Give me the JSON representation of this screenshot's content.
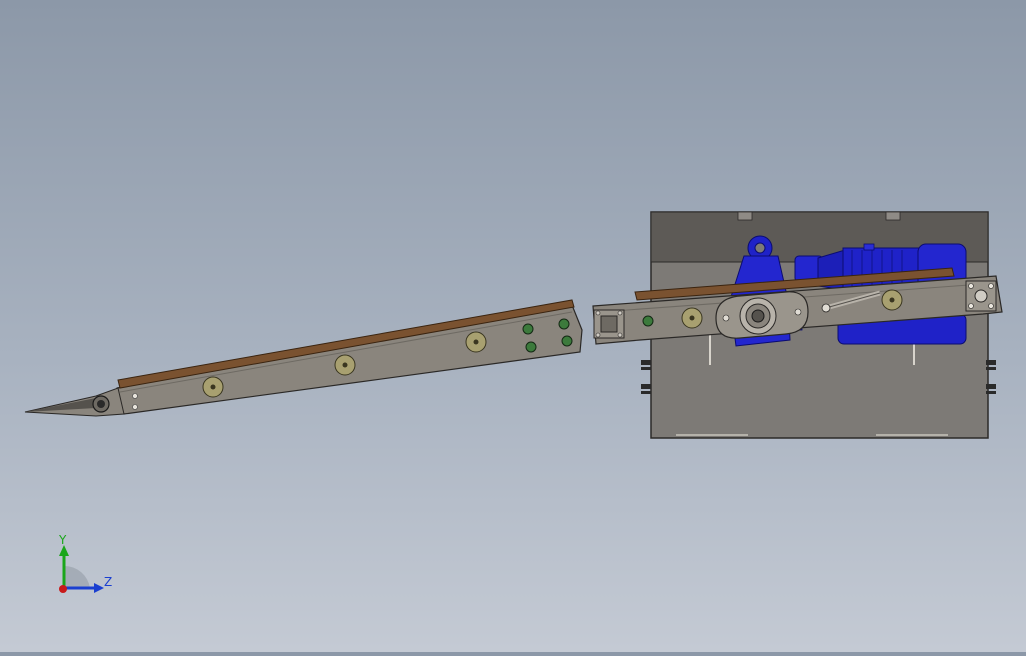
{
  "viewport": {
    "background_top": "#8c98a8",
    "background_bottom": "#c4cad4"
  },
  "colors": {
    "frame_gray": "#8a857d",
    "frame_dark": "#55524d",
    "belt_brown": "#7a5230",
    "motor_blue": "#1f22c8",
    "roller_olive": "#a8a070",
    "bolt_green": "#3c7a3c",
    "cabinet_face": "#7d7a76",
    "cabinet_top": "#5d5a56"
  },
  "triad": {
    "y_label": "Y",
    "z_label": "Z",
    "y_color": "#1aa61a",
    "z_color": "#1a3fd0",
    "origin_color": "#c81a1a"
  }
}
